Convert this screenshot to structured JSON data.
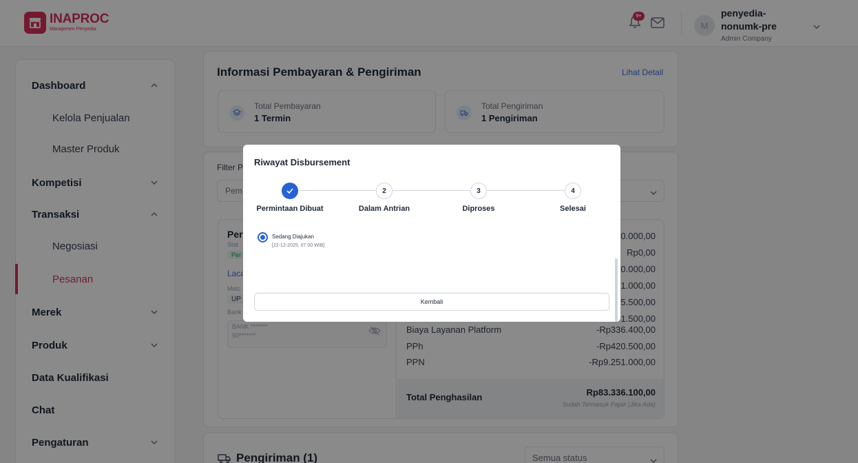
{
  "header": {
    "logo_title": "INAPROC",
    "logo_subtitle": "Manajemen Penyedia",
    "notif_badge": "9+",
    "user_name": "penyedia-nonumk-pre",
    "user_role": "Admin Company",
    "avatar_initial": "M"
  },
  "sidebar": {
    "items": [
      {
        "label": "Dashboard",
        "type": "group",
        "chevron": "up"
      },
      {
        "label": "Kelola Penjualan",
        "type": "sub"
      },
      {
        "label": "Master Produk",
        "type": "sub"
      },
      {
        "label": "Kompetisi",
        "type": "group",
        "chevron": "down"
      },
      {
        "label": "Transaksi",
        "type": "group",
        "chevron": "up"
      },
      {
        "label": "Negosiasi",
        "type": "sub"
      },
      {
        "label": "Pesanan",
        "type": "sub",
        "active": true
      },
      {
        "label": "Merek",
        "type": "group",
        "chevron": "down"
      },
      {
        "label": "Produk",
        "type": "group",
        "chevron": "down"
      },
      {
        "label": "Data Kualifikasi",
        "type": "group"
      },
      {
        "label": "Chat",
        "type": "group"
      },
      {
        "label": "Pengaturan",
        "type": "group",
        "chevron": "down"
      }
    ]
  },
  "info": {
    "title": "Informasi Pembayaran & Pengiriman",
    "detail_link": "Lihat Detail",
    "payment_label": "Total Pembayaran",
    "payment_value": "1 Termin",
    "shipping_label": "Total Pengiriman",
    "shipping_value": "1 Pengiriman"
  },
  "filter": {
    "label": "Filter P",
    "select_text": "Pem"
  },
  "order": {
    "title": "Per",
    "line1": "Stat",
    "badge": "Per",
    "link": "Laca",
    "line2": "Metc",
    "chip": "UP",
    "line3": "Bank",
    "bank_name": "BANK *******",
    "bank_account": "50*******"
  },
  "breakdown": {
    "rows": [
      {
        "label": "",
        "value": "0.000,00"
      },
      {
        "label": "",
        "value": "Rp0,00"
      },
      {
        "label": "",
        "value": "0.000,00"
      },
      {
        "label": "",
        "value": "1.000,00"
      },
      {
        "label": "",
        "value": "5.500,00"
      },
      {
        "label": "",
        "value": "1.500,00"
      },
      {
        "label": "Biaya Layanan Platform",
        "value": "-Rp336.400,00"
      },
      {
        "label": "PPh",
        "value": "-Rp420.500,00"
      },
      {
        "label": "PPN",
        "value": "-Rp9.251.000,00"
      }
    ],
    "total_label": "Total Penghasilan",
    "total_value": "Rp83.336.100,00",
    "total_note": "Sudah Termasuk Pajak (Jika Ada)"
  },
  "shipping": {
    "title": "Pengiriman (1)",
    "status_select": "Semua status"
  },
  "modal": {
    "title": "Riwayat Disbursement",
    "steps": [
      {
        "number": "1",
        "label": "Permintaan Dibuat",
        "done": true
      },
      {
        "number": "2",
        "label": "Dalam Antrian",
        "done": false
      },
      {
        "number": "3",
        "label": "Diproses",
        "done": false
      },
      {
        "number": "4",
        "label": "Selesai",
        "done": false
      }
    ],
    "status_name": "Sedang Diajukan",
    "status_time": "[22-12-2025, 07.00 WIB]",
    "back_button": "Kembali"
  },
  "colors": {
    "brand": "#d6305a",
    "primary": "#2563d6",
    "link": "#3b6fd6"
  }
}
